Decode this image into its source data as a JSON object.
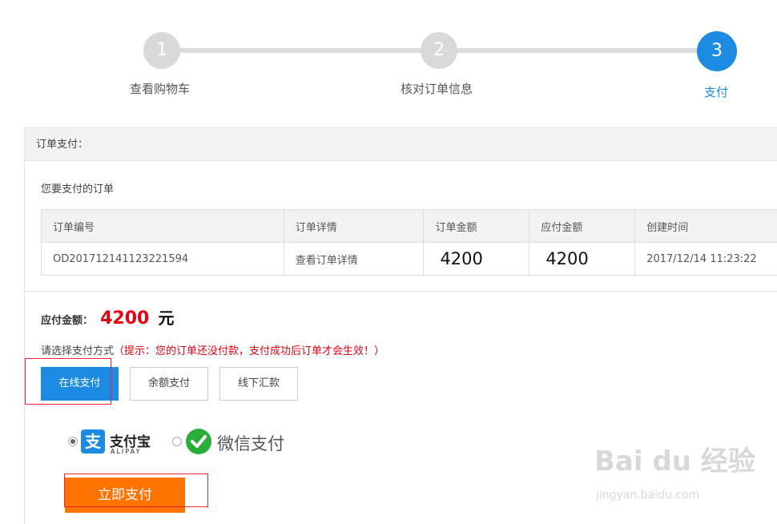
{
  "steps": [
    {
      "number": "1",
      "label": "查看购物车"
    },
    {
      "number": "2",
      "label": "核对订单信息"
    },
    {
      "number": "3",
      "label": "支付"
    }
  ],
  "panel": {
    "header": "订单支付：",
    "subtitle": "您要支付的订单"
  },
  "orders_table": {
    "headers": [
      "订单编号",
      "订单详情",
      "订单金额",
      "应付金额",
      "创建时间"
    ],
    "rows": [
      [
        "OD201712141123221594",
        "查看订单详情",
        "4200",
        "4200",
        "2017/12/14 11:23:22"
      ]
    ]
  },
  "amount": {
    "label": "应付金额：",
    "value": "4200",
    "unit": "元"
  },
  "method_hint": {
    "text": "请选择支付方式",
    "warning": "（提示：您的订单还没付款，支付成功后订单才会生效！）"
  },
  "tabs": [
    {
      "label": "在线支付",
      "active": true
    },
    {
      "label": "余额支付",
      "active": false
    },
    {
      "label": "线下汇款",
      "active": false
    }
  ],
  "payment_options": {
    "alipay_name": "支付宝",
    "alipay_sub": "ALIPAY",
    "alipay_icon": "支",
    "wechat_name": "微信支付",
    "selected": "alipay"
  },
  "pay_button": "立即支付",
  "watermark": {
    "main": "Bai du 经验",
    "sub": "jingyan.baidu.com"
  },
  "colors": {
    "accent": "#1e8be3",
    "price": "#e60012",
    "pay_button": "#ff7300",
    "wechat": "#2aae3b"
  }
}
